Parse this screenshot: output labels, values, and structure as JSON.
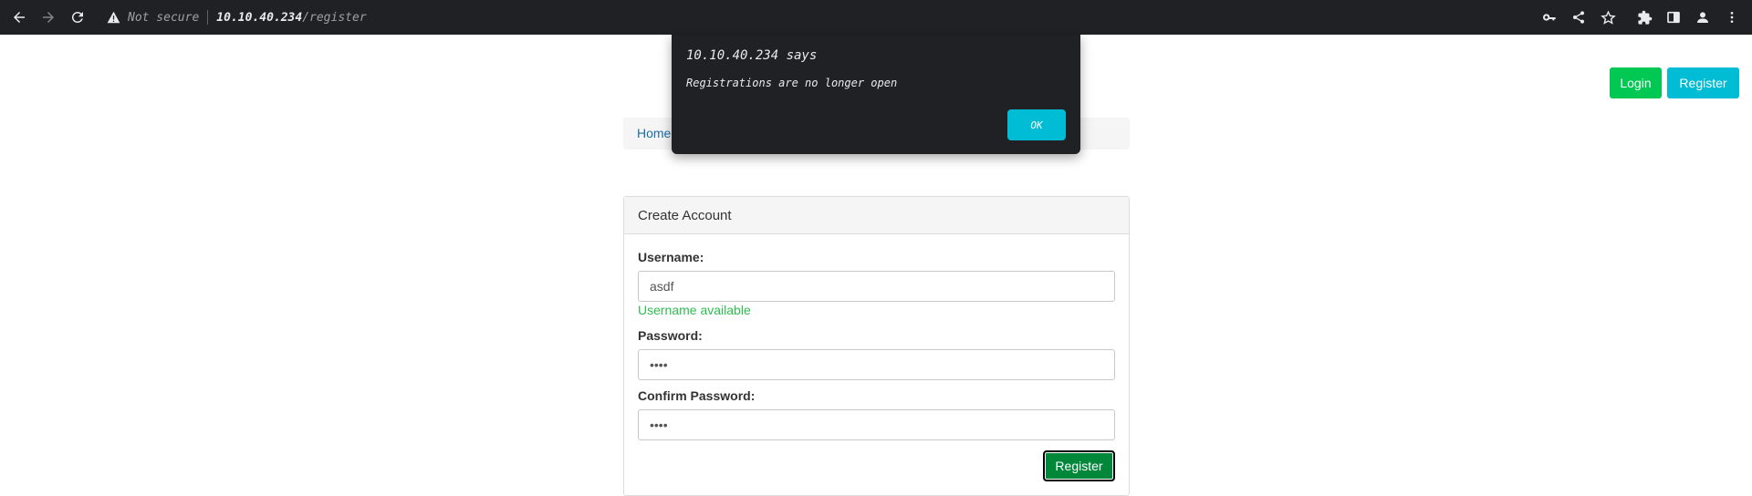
{
  "browser": {
    "security_label": "Not secure",
    "url_host": "10.10.40.234",
    "url_path": "/register"
  },
  "nav": {
    "login_label": "Login",
    "register_label": "Register"
  },
  "breadcrumb": {
    "home_label": "Home"
  },
  "panel": {
    "title": "Create Account",
    "username_label": "Username:",
    "username_value": "asdf",
    "username_status": "Username available",
    "password_label": "Password:",
    "password_value": "••••",
    "confirm_label": "Confirm Password:",
    "confirm_value": "••••",
    "submit_label": "Register"
  },
  "dialog": {
    "title": "10.10.40.234 says",
    "message": "Registrations are no longer open",
    "ok_label": "OK"
  },
  "colors": {
    "toolbar_bg": "#202124",
    "login_green": "#00c853",
    "register_cyan": "#00bcd4",
    "submit_green": "#00873a",
    "available_green": "#2ebd4e",
    "link_blue": "#1b6fa8"
  },
  "icons": [
    "back-arrow-icon",
    "forward-arrow-icon",
    "reload-icon",
    "warning-icon",
    "key-icon",
    "share-icon",
    "star-icon",
    "extensions-icon",
    "side-panel-icon",
    "profile-icon",
    "menu-icon"
  ]
}
